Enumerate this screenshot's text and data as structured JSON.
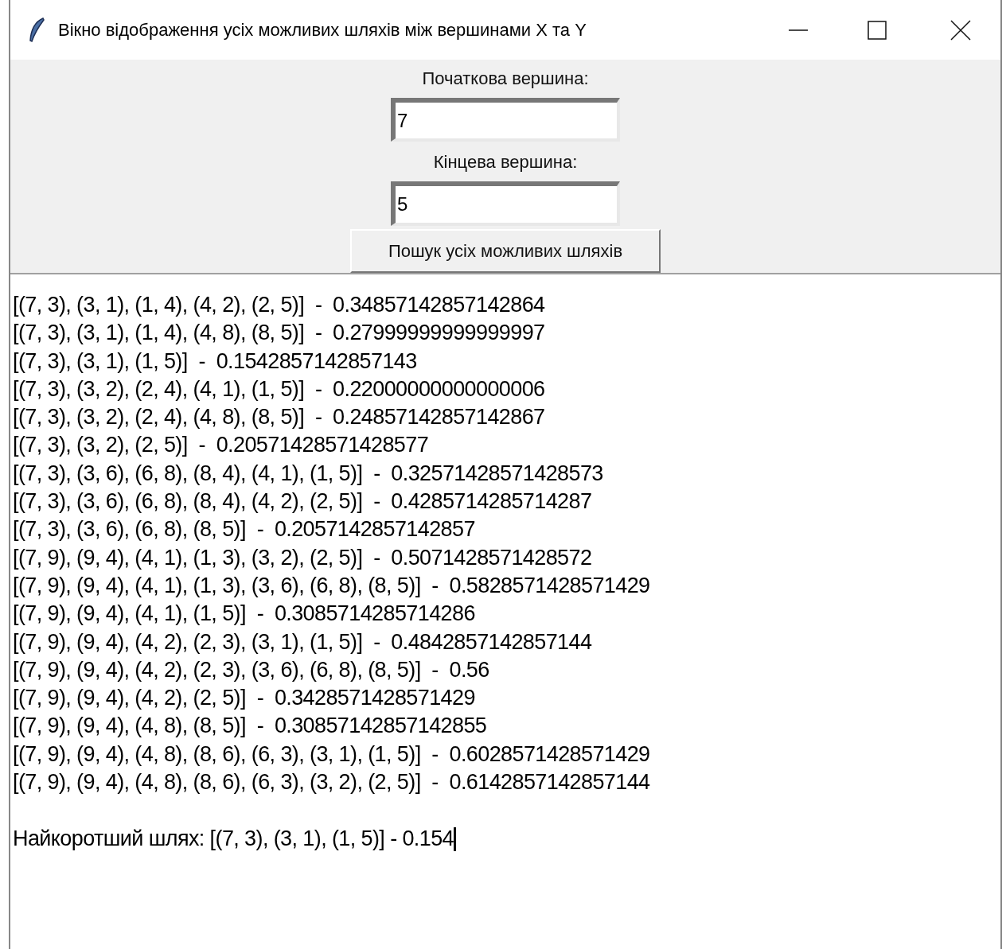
{
  "window": {
    "title": "Вікно відображення усіх можливих шляхів між вершинами X та Y"
  },
  "form": {
    "start_label": "Початкова вершина:",
    "start_value": "7",
    "end_label": "Кінцева вершина:",
    "end_value": "5",
    "search_button": "Пошук усіх можливих шляхів"
  },
  "output": {
    "lines": [
      "[(7, 3), (3, 1), (1, 4), (4, 2), (2, 5)]  -  0.34857142857142864",
      "[(7, 3), (3, 1), (1, 4), (4, 8), (8, 5)]  -  0.27999999999999997",
      "[(7, 3), (3, 1), (1, 5)]  -  0.1542857142857143",
      "[(7, 3), (3, 2), (2, 4), (4, 1), (1, 5)]  -  0.22000000000000006",
      "[(7, 3), (3, 2), (2, 4), (4, 8), (8, 5)]  -  0.24857142857142867",
      "[(7, 3), (3, 2), (2, 5)]  -  0.20571428571428577",
      "[(7, 3), (3, 6), (6, 8), (8, 4), (4, 1), (1, 5)]  -  0.32571428571428573",
      "[(7, 3), (3, 6), (6, 8), (8, 4), (4, 2), (2, 5)]  -  0.4285714285714287",
      "[(7, 3), (3, 6), (6, 8), (8, 5)]  -  0.2057142857142857",
      "[(7, 9), (9, 4), (4, 1), (1, 3), (3, 2), (2, 5)]  -  0.5071428571428572",
      "[(7, 9), (9, 4), (4, 1), (1, 3), (3, 6), (6, 8), (8, 5)]  -  0.5828571428571429",
      "[(7, 9), (9, 4), (4, 1), (1, 5)]  -  0.3085714285714286",
      "[(7, 9), (9, 4), (4, 2), (2, 3), (3, 1), (1, 5)]  -  0.4842857142857144",
      "[(7, 9), (9, 4), (4, 2), (2, 3), (3, 6), (6, 8), (8, 5)]  -  0.56",
      "[(7, 9), (9, 4), (4, 2), (2, 5)]  -  0.3428571428571429",
      "[(7, 9), (9, 4), (4, 8), (8, 5)]  -  0.30857142857142855",
      "[(7, 9), (9, 4), (4, 8), (8, 6), (6, 3), (3, 1), (1, 5)]  -  0.6028571428571429",
      "[(7, 9), (9, 4), (4, 8), (8, 6), (6, 3), (3, 2), (2, 5)]  -  0.6142857142857144"
    ],
    "shortest": "Найкоротший шлях: [(7, 3), (3, 1), (1, 5)] - 0.154"
  }
}
